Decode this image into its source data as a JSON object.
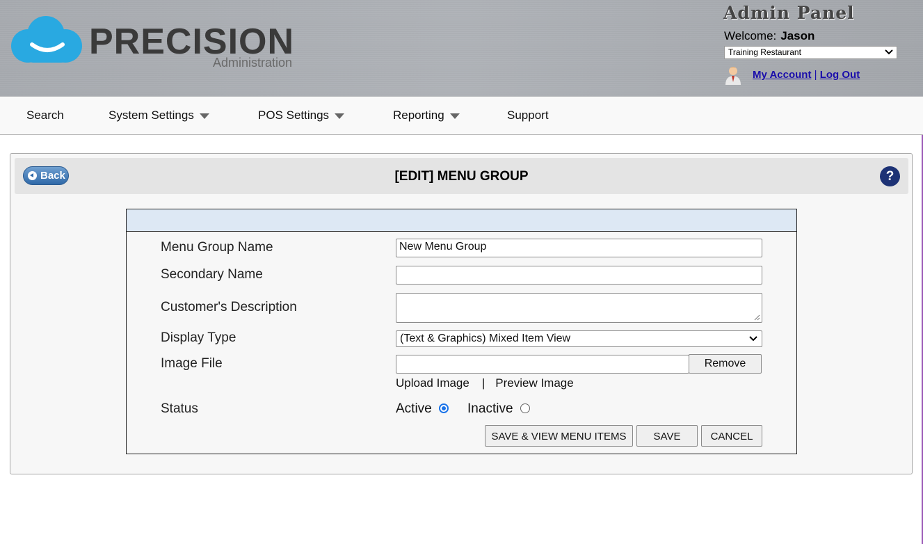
{
  "header": {
    "logo_text": "PRECISION",
    "logo_sub": "Administration",
    "admin_title": "Admin Panel",
    "welcome_label": "Welcome:",
    "user_name": "Jason",
    "restaurant": "Training Restaurant",
    "my_account": "My Account",
    "separator": "|",
    "logout": "Log Out"
  },
  "nav": {
    "items": [
      {
        "label": "Search"
      },
      {
        "label": "System Settings"
      },
      {
        "label": "POS Settings"
      },
      {
        "label": "Reporting"
      },
      {
        "label": "Support"
      }
    ]
  },
  "panel": {
    "back_label": "Back",
    "title": "[EDIT] MENU GROUP",
    "help_label": "?"
  },
  "form": {
    "menu_group_name_label": "Menu Group Name",
    "menu_group_name_value": "New Menu Group",
    "secondary_name_label": "Secondary Name",
    "secondary_name_value": "",
    "customer_description_label": "Customer's Description",
    "customer_description_value": "",
    "display_type_label": "Display Type",
    "display_type_value": "(Text & Graphics) Mixed Item View",
    "image_file_label": "Image File",
    "image_file_value": "",
    "remove_label": "Remove",
    "upload_image": "Upload Image",
    "link_separator": "|",
    "preview_image": "Preview Image",
    "status_label": "Status",
    "status_active": "Active",
    "status_inactive": "Inactive",
    "selected_status": "Active",
    "save_view_label": "SAVE & VIEW MENU ITEMS",
    "save_label": "SAVE",
    "cancel_label": "CANCEL"
  },
  "colors": {
    "brand_cloud": "#29a9e1",
    "help_icon": "#1d3275",
    "link": "#1a0dab",
    "form_header": "#dde8f4"
  }
}
